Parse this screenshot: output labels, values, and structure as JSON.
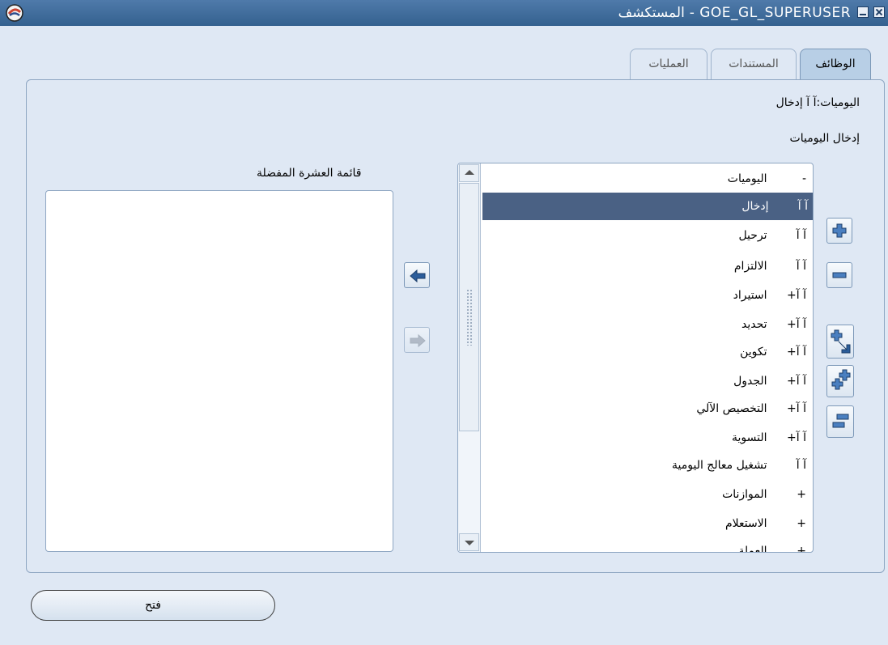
{
  "window": {
    "title": "GOE_GL_SUPERUSER - المستكشف"
  },
  "tabs": [
    {
      "label": "الوظائف",
      "active": true
    },
    {
      "label": "المستندات",
      "active": false
    },
    {
      "label": "العمليات",
      "active": false
    }
  ],
  "path_label": "اليوميات:آ آ   إدخال",
  "section_label": "إدخال اليوميات",
  "favorites_label": "قائمة العشرة المفضلة",
  "tree_items": [
    {
      "prefix": "-",
      "label": "اليوميات",
      "selected": false
    },
    {
      "prefix": "آ آ",
      "label": "إدخال",
      "selected": true
    },
    {
      "prefix": "آ آ",
      "label": "ترحيل",
      "selected": false
    },
    {
      "prefix": "آ آ",
      "label": "الالتزام",
      "selected": false
    },
    {
      "prefix": "آ آ+",
      "label": "استيراد",
      "selected": false
    },
    {
      "prefix": "آ آ+",
      "label": "تحديد",
      "selected": false
    },
    {
      "prefix": "آ آ+",
      "label": "تكوين",
      "selected": false
    },
    {
      "prefix": "آ آ+",
      "label": "الجدول",
      "selected": false
    },
    {
      "prefix": "آ آ+",
      "label": "التخصيص الآلي",
      "selected": false
    },
    {
      "prefix": "آ آ+",
      "label": "التسوية",
      "selected": false
    },
    {
      "prefix": "آ آ",
      "label": "تشغيل معالج اليومية",
      "selected": false
    },
    {
      "prefix": "+",
      "label": "الموازنات",
      "selected": false
    },
    {
      "prefix": "+",
      "label": "الاستعلام",
      "selected": false
    },
    {
      "prefix": "+",
      "label": "العملة",
      "selected": false
    }
  ],
  "favorites_items": [],
  "buttons": {
    "open_label": "فتح"
  },
  "colors": {
    "selected_row": "#4a6184",
    "title_bar": "#34618f",
    "background": "#dfe8f4"
  }
}
